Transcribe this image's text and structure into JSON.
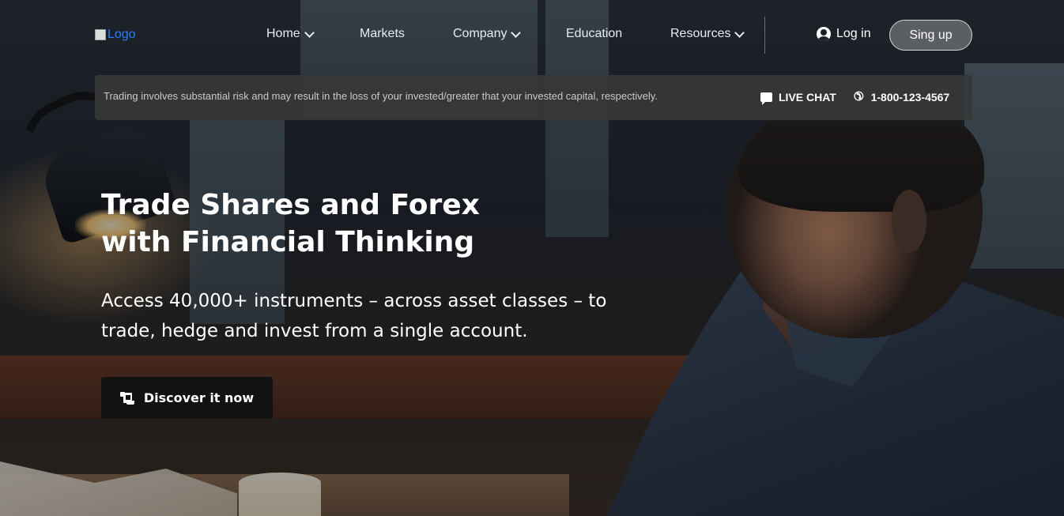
{
  "header": {
    "logo_alt": "Logo",
    "nav": [
      {
        "label": "Home",
        "has_dropdown": true
      },
      {
        "label": "Markets",
        "has_dropdown": false
      },
      {
        "label": "Company",
        "has_dropdown": true
      },
      {
        "label": "Education",
        "has_dropdown": false
      },
      {
        "label": "Resources",
        "has_dropdown": true
      }
    ],
    "login_label": "Log in",
    "signup_label": "Sing up"
  },
  "infobar": {
    "risk_text": "Trading involves substantial risk and may result in the loss of your invested/greater that your invested capital, respectively.",
    "live_chat_label": "LIVE CHAT",
    "phone_number": "1-800-123-4567"
  },
  "hero": {
    "title": "Trade Shares and Forex with Financial Thinking",
    "subtitle": "Access 40,000+ instruments – across asset classes – to trade, hedge and invest from a single account.",
    "cta_label": "Discover it now"
  },
  "colors": {
    "logo_link": "#2a7cff",
    "infobar_bg": "#373737",
    "cta_bg": "#121212",
    "text": "#ffffff"
  },
  "icons": {
    "user": "user-circle-icon",
    "chat": "chat-bubble-icon",
    "phone": "phone-icon",
    "cta": "scroll-icon",
    "dropdown": "chevron-down-icon"
  }
}
